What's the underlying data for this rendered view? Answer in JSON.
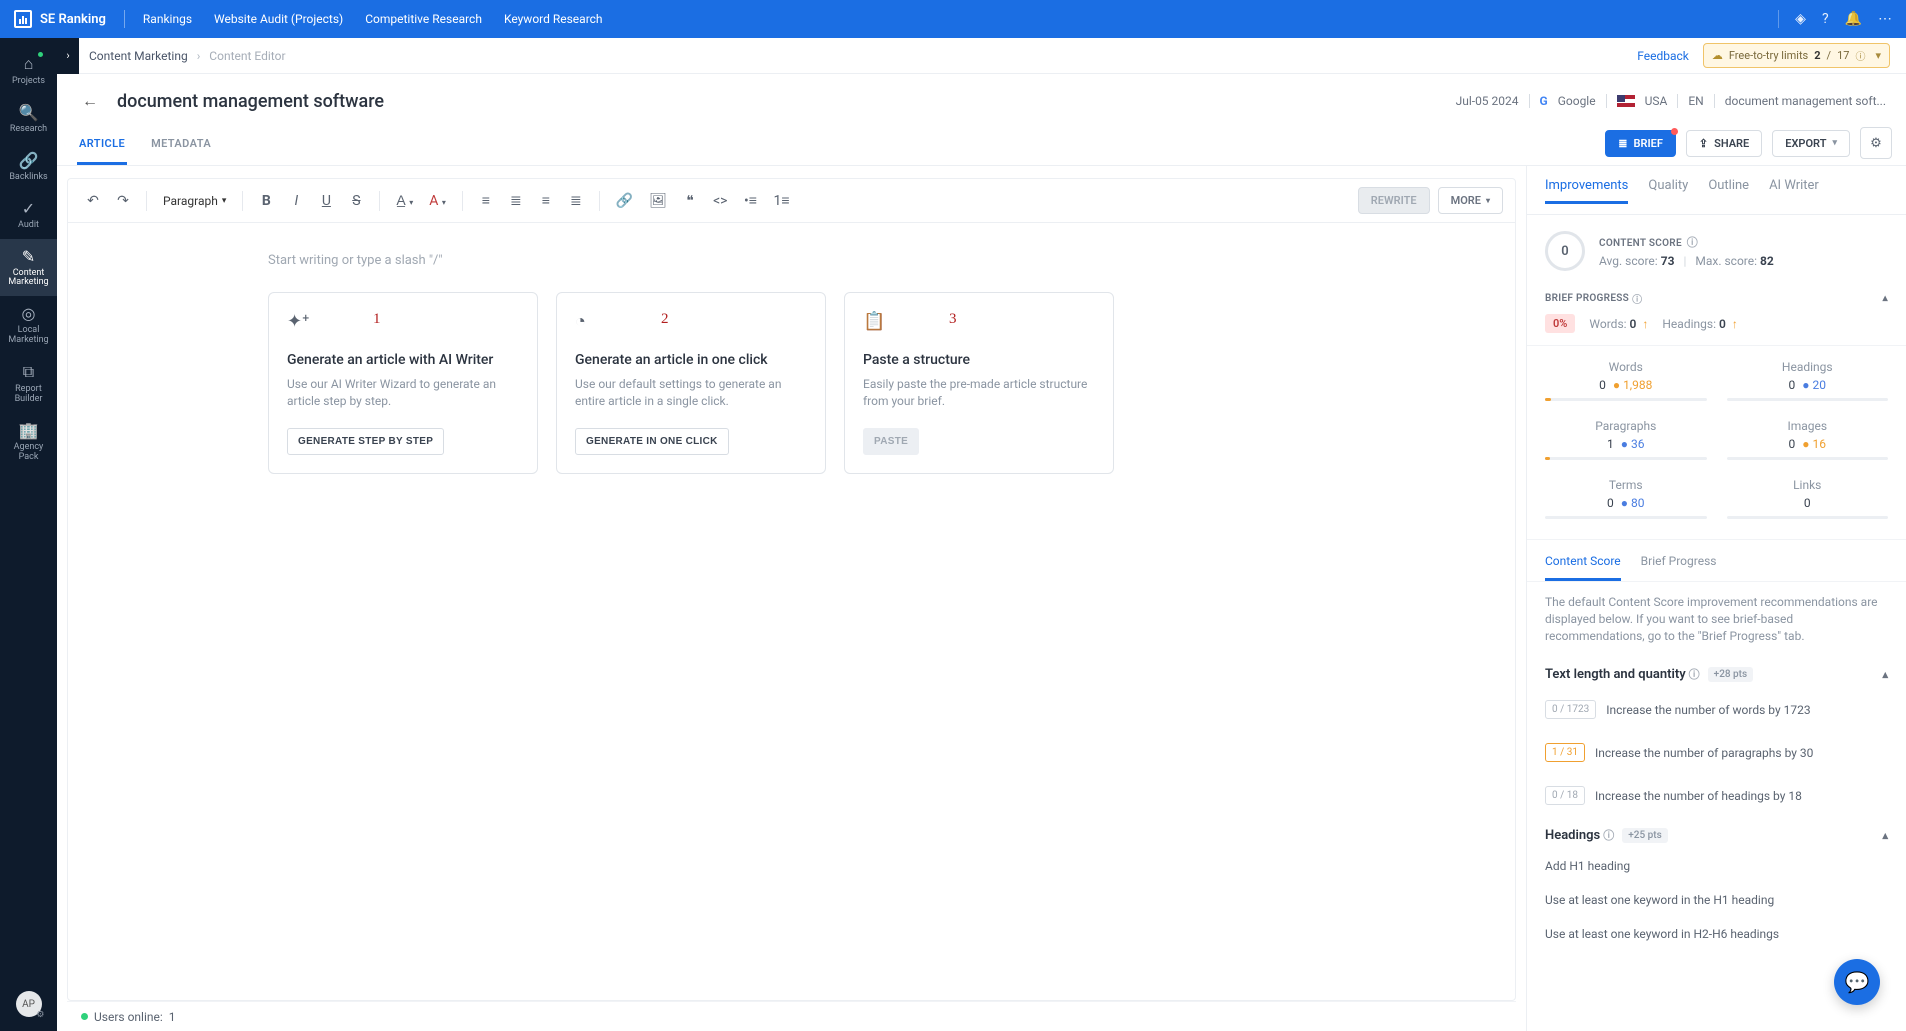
{
  "topnav": {
    "brand": "SE Ranking",
    "links": [
      "Rankings",
      "Website Audit (Projects)",
      "Competitive Research",
      "Keyword Research"
    ]
  },
  "sidebar": {
    "items": [
      {
        "icon": "home",
        "label": "Projects",
        "dot": true
      },
      {
        "icon": "search",
        "label": "Research"
      },
      {
        "icon": "link",
        "label": "Backlinks"
      },
      {
        "icon": "check",
        "label": "Audit"
      },
      {
        "icon": "edit",
        "label": "Content\nMarketing",
        "active": true
      },
      {
        "icon": "pin",
        "label": "Local\nMarketing"
      },
      {
        "icon": "report",
        "label": "Report\nBuilder"
      },
      {
        "icon": "agency",
        "label": "Agency\nPack"
      }
    ],
    "avatar": "AP"
  },
  "crumb": {
    "a": "Content Marketing",
    "b": "Content Editor",
    "feedback": "Feedback",
    "quota_label": "Free-to-try limits",
    "quota_used": "2",
    "quota_total": "17"
  },
  "title": {
    "text": "document management software",
    "date": "Jul-05 2024",
    "engine": "Google",
    "country": "USA",
    "lang": "EN",
    "kw": "document management soft..."
  },
  "tabs": {
    "article": "ARTICLE",
    "metadata": "METADATA"
  },
  "actions": {
    "brief": "BRIEF",
    "share": "SHARE",
    "export": "EXPORT"
  },
  "toolbar": {
    "paragraph": "Paragraph",
    "rewrite": "REWRITE",
    "more": "MORE"
  },
  "editor": {
    "placeholder": "Start writing or type a slash \"/\"",
    "cards": [
      {
        "num": "1",
        "title": "Generate an article with AI Writer",
        "desc": "Use our AI Writer Wizard to generate an article step by step.",
        "btn": "GENERATE STEP BY STEP",
        "icon": "✦"
      },
      {
        "num": "2",
        "title": "Generate an article in one click",
        "desc": "Use our default settings to generate an entire article in a single click.",
        "btn": "GENERATE IN ONE CLICK",
        "icon": "speed"
      },
      {
        "num": "3",
        "title": "Paste a structure",
        "desc": "Easily paste the pre-made article structure from your brief.",
        "btn": "PASTE",
        "icon": "clip",
        "disabled": true
      }
    ]
  },
  "status": {
    "label": "Users online:",
    "value": "1"
  },
  "rpanel": {
    "tabs": [
      "Improvements",
      "Quality",
      "Outline",
      "AI Writer"
    ],
    "score_label": "CONTENT SCORE",
    "score": "0",
    "avg_lbl": "Avg. score:",
    "avg": "73",
    "max_lbl": "Max. score:",
    "max": "82",
    "brief_hdr": "BRIEF PROGRESS",
    "pct": "0%",
    "words_lbl": "Words:",
    "words": "0",
    "headings_lbl": "Headings:",
    "headings": "0",
    "stats": [
      {
        "name": "Words",
        "val": "0",
        "tgt": "1,988",
        "tc": "orange"
      },
      {
        "name": "Headings",
        "val": "0",
        "tgt": "20",
        "tc": "blue"
      },
      {
        "name": "Paragraphs",
        "val": "1",
        "tgt": "36",
        "tc": "blue"
      },
      {
        "name": "Images",
        "val": "0",
        "tgt": "16",
        "tc": "orange"
      },
      {
        "name": "Terms",
        "val": "0",
        "tgt": "80",
        "tc": "blue"
      },
      {
        "name": "Links",
        "val": "0",
        "tgt": "",
        "tc": ""
      }
    ],
    "subtabs": [
      "Content Score",
      "Brief Progress"
    ],
    "note": "The default Content Score improvement recommendations are displayed below. If you want to see brief-based recommendations, go to the \"Brief Progress\" tab.",
    "sec1": {
      "title": "Text length and quantity",
      "pts": "+28 pts",
      "items": [
        {
          "badge": "0 / 1723",
          "warn": false,
          "text": "Increase the number of words by 1723"
        },
        {
          "badge": "1 / 31",
          "warn": true,
          "text": "Increase the number of paragraphs by 30"
        },
        {
          "badge": "0 / 18",
          "warn": false,
          "text": "Increase the number of headings by 18"
        }
      ]
    },
    "sec2": {
      "title": "Headings",
      "pts": "+25 pts",
      "items": [
        "Add H1 heading",
        "Use at least one keyword in the H1 heading",
        "Use at least one keyword in H2-H6 headings"
      ]
    }
  }
}
